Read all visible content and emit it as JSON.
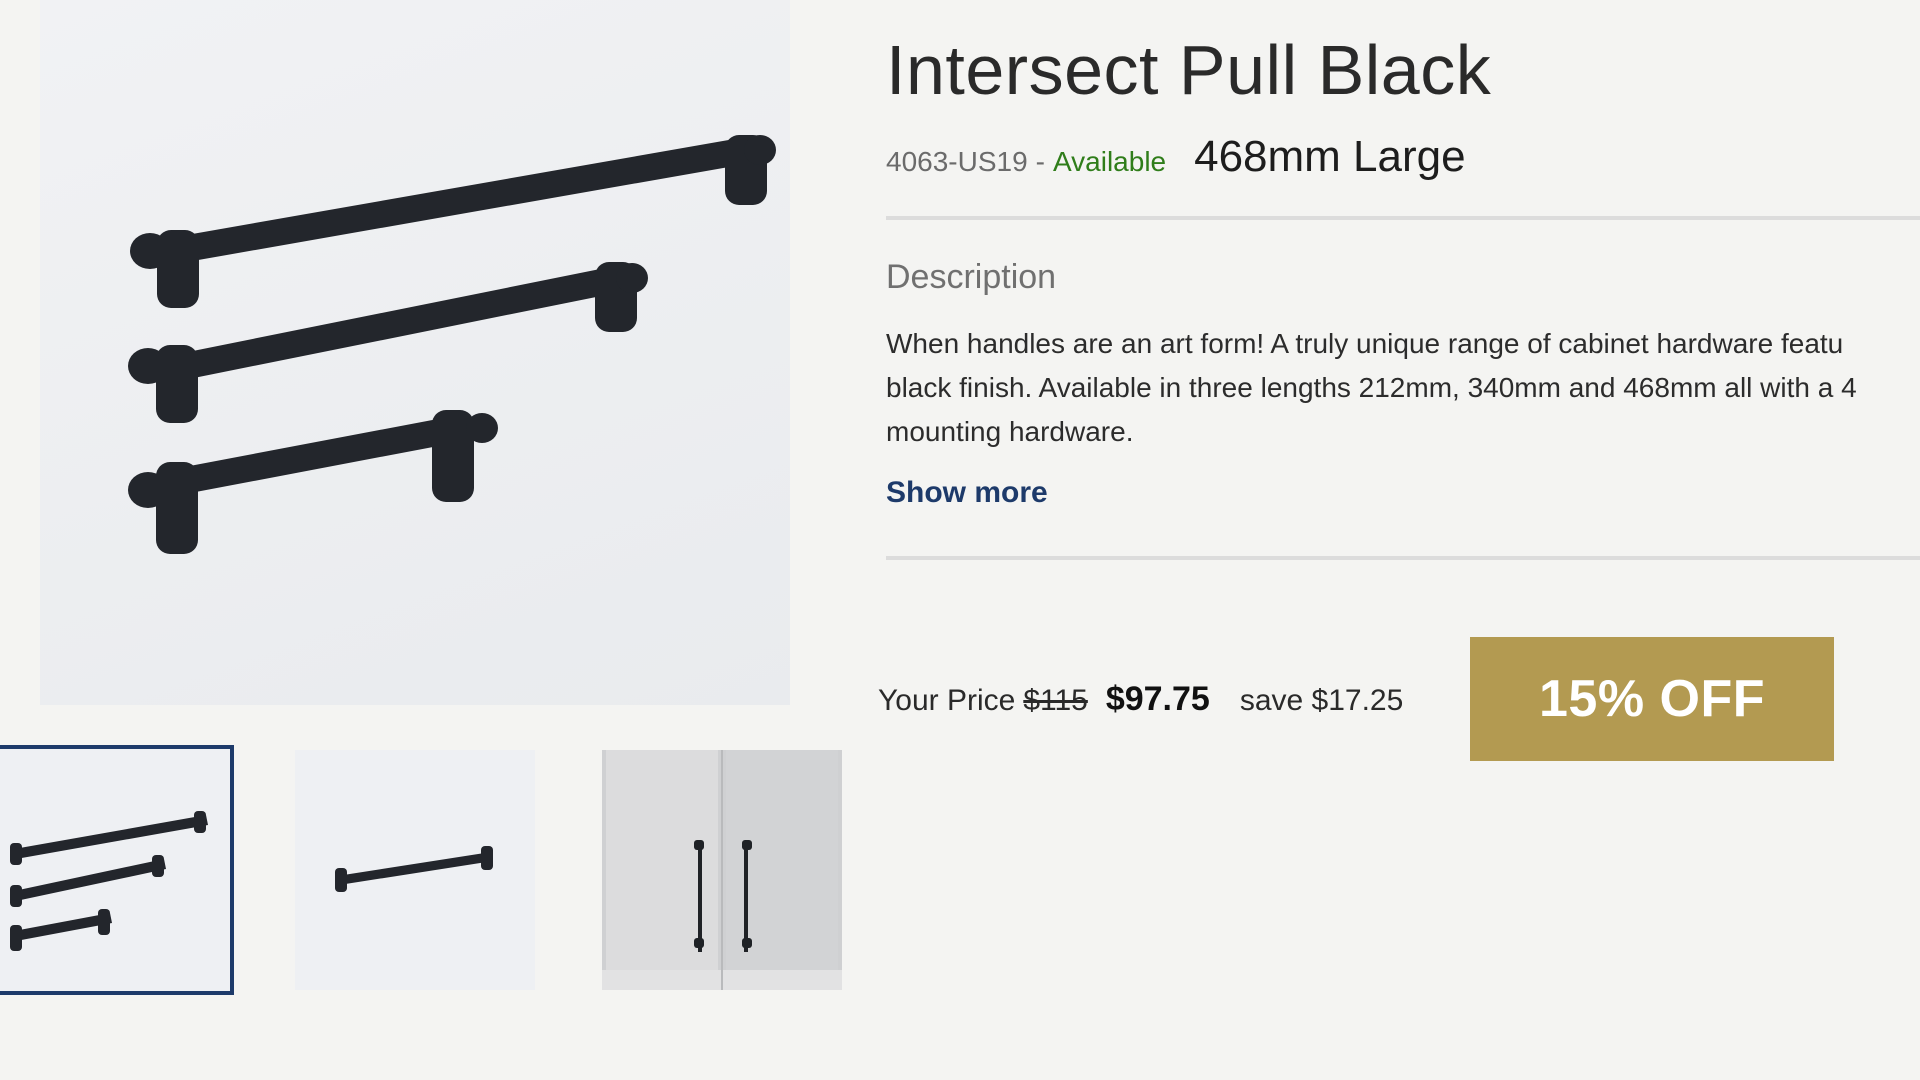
{
  "product": {
    "title": "Intersect Pull Black",
    "sku": "4063-US19",
    "separator": "-",
    "availability": "Available",
    "variant": "468mm Large"
  },
  "description": {
    "heading": "Description",
    "body": "When handles are an art form! A truly unique range of cabinet hardware featu\nblack finish. Available in three lengths 212mm, 340mm and 468mm all with a 4\nmounting hardware.",
    "show_more_label": "Show more"
  },
  "pricing": {
    "label": "Your Price",
    "original": "$115",
    "current": "$97.75",
    "savings": "save $17.25",
    "discount_badge": "15% OFF"
  },
  "gallery": {
    "selected_index": 0,
    "thumbnails": [
      {
        "icon": "three-pulls-image"
      },
      {
        "icon": "single-pull-image"
      },
      {
        "icon": "cabinet-doors-image"
      }
    ]
  },
  "colors": {
    "title": "#2a2a2a",
    "available": "#2f7d1a",
    "link": "#1d3a6a",
    "badge_bg": "#b39a51",
    "selected_border": "#1d3a6a"
  }
}
